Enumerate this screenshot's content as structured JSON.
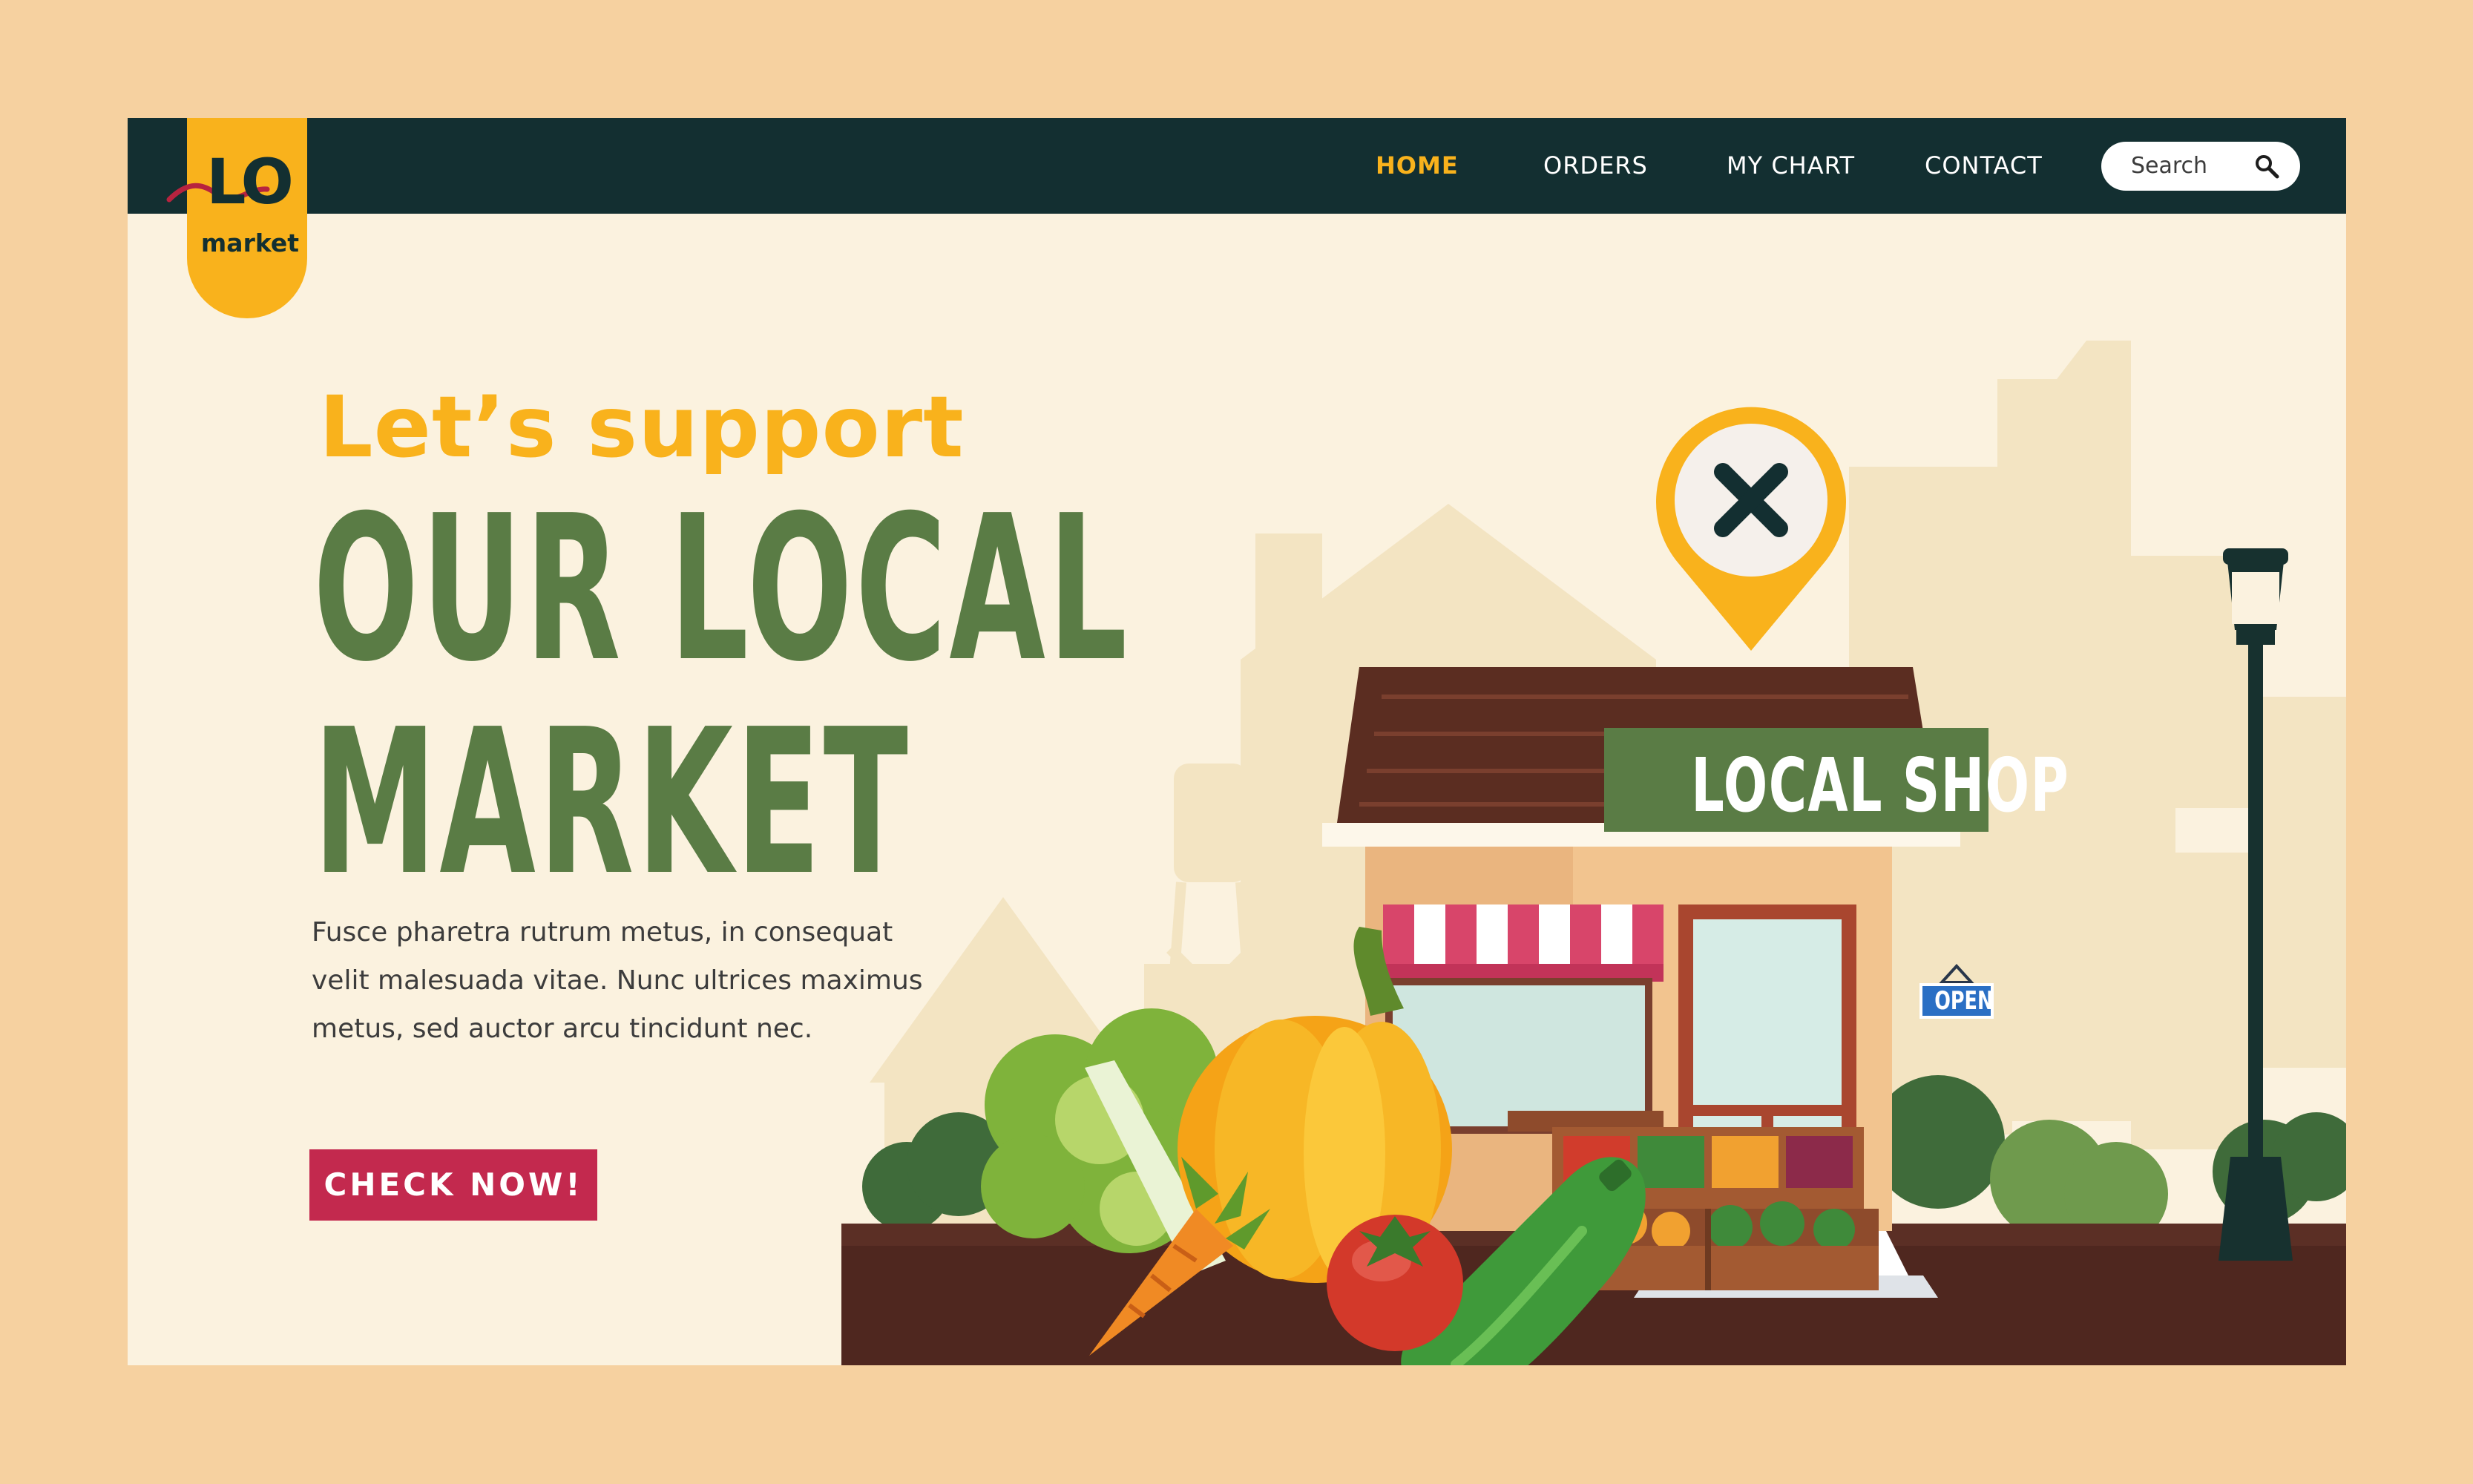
{
  "brand": {
    "logo_top": "LO",
    "logo_bottom": "market"
  },
  "nav": {
    "items": [
      {
        "label": "HOME",
        "active": true
      },
      {
        "label": "ORDERS",
        "active": false
      },
      {
        "label": "MY CHART",
        "active": false
      },
      {
        "label": "CONTACT",
        "active": false
      }
    ],
    "search": {
      "placeholder": "Search",
      "icon": "search-icon"
    }
  },
  "hero": {
    "kicker": "Let’s support",
    "title_line1": "OUR LOCAL",
    "title_line2": "MARKET",
    "description": "Fusce pharetra rutrum metus, in consequat velit malesuada vitae. Nunc ultrices maximus metus, sed auctor arcu tincidunt nec.",
    "cta_label": "CHECK NOW!"
  },
  "illustration": {
    "shop_sign": "LOCAL SHOP",
    "door_sign": "OPEN",
    "pin_icon": "close-icon"
  },
  "colors": {
    "page_bg": "#f6d1a0",
    "frame_bg": "#fbf2df",
    "nav_bg": "#132f31",
    "accent_yellow": "#f9b21c",
    "title_green": "#5a7c45",
    "cta_red": "#c3294e"
  }
}
